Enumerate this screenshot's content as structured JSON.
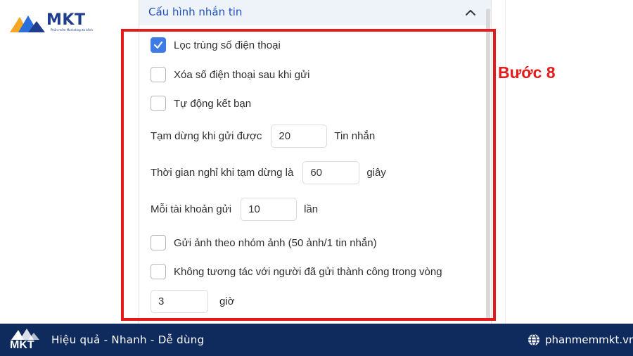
{
  "logo": {
    "text": "MKT",
    "subtitle": "Phần mềm Marketing đa kênh"
  },
  "panel": {
    "title": "Cấu hình nhắn tin"
  },
  "step_label": "Bước 8",
  "options": {
    "dedupe_phone": {
      "label": "Lọc trùng số điện thoại",
      "checked": true
    },
    "delete_phone_after_send": {
      "label": "Xóa số điện thoại sau khi gửi",
      "checked": false
    },
    "auto_add_friend": {
      "label": "Tự động kết bạn",
      "checked": false
    },
    "send_image_group": {
      "label": "Gửi ảnh theo nhóm ảnh (50 ảnh/1 tin nhắn)",
      "checked": false
    },
    "skip_interacted": {
      "label": "Không tương tác với người đã gửi thành công trong vòng",
      "checked": false
    }
  },
  "pause_after": {
    "prefix": "Tạm dừng khi gửi được",
    "value": "20",
    "suffix": "Tin nhắn"
  },
  "pause_duration": {
    "prefix": "Thời gian nghỉ khi tạm dừng là",
    "value": "60",
    "suffix": "giây"
  },
  "per_account": {
    "prefix": "Mỗi tài khoản gửi",
    "value": "10",
    "suffix": "lần"
  },
  "skip_hours": {
    "value": "3",
    "suffix": "giờ"
  },
  "footer": {
    "logo_text": "MKT",
    "slogan": "Hiệu quả - Nhanh  - Dễ dùng",
    "website": "phanmemmkt.vn"
  },
  "colors": {
    "accent": "#3d7be8",
    "highlight": "#e51b1b",
    "footer_bg": "#0f2a5c",
    "title": "#1d4fb8"
  }
}
